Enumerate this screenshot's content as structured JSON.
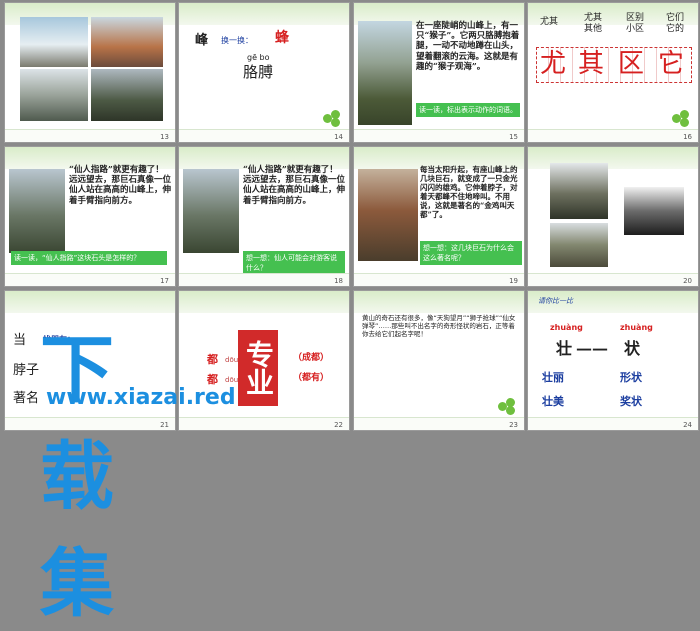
{
  "slides": {
    "s13": {
      "num": "13"
    },
    "s14": {
      "num": "14",
      "left": "峰",
      "mid": "换一换：",
      "right": "蜂",
      "pinyin": "gē bo",
      "word": "胳膊"
    },
    "s15": {
      "num": "15",
      "text": "在一座陡峭的山峰上，有一只“猴子”。它两只胳膊抱着腿，一动不动地蹲在山头，望着翻滚的云海。这就是有趣的“猴子观海”。",
      "note": "读一读，标出表示动作的词语。"
    },
    "s16": {
      "num": "16",
      "h1": "尤其",
      "h2": "尤其其他",
      "h3": "区别小区",
      "h4": "它们它的",
      "chars": [
        "尤",
        "其",
        "区",
        "它"
      ]
    },
    "s17": {
      "num": "17",
      "text": "“仙人指路”就更有趣了！远远望去，那巨石真像一位仙人站在高高的山峰上，伸着手臂指向前方。",
      "note": "读一读，“仙人指路”这块石头是怎样的？"
    },
    "s18": {
      "num": "18",
      "text": "“仙人指路”就更有趣了！远远望去，那巨石真像一位仙人站在高高的山峰上，伸着手臂指向前方。",
      "note": "想一想：仙人可能会对游客说什么？"
    },
    "s19": {
      "num": "19",
      "text": "每当太阳升起，有座山峰上的几块巨石，就变成了一只金光闪闪的雄鸡。它伸着脖子，对着天都峰不住地啼叫。不用说，这就是著名的“金鸡叫天都”了。",
      "note": "想一想：这几块巨石为什么会这么著名呢？"
    },
    "s20": {
      "num": "20"
    },
    "s21": {
      "num": "21",
      "w1": "当",
      "w2": "脖子",
      "w3": "著名",
      "find": "找朋友："
    },
    "s22": {
      "num": "22",
      "a1": "都",
      "p1": "dōu",
      "r1": "（成都）",
      "a2": "都",
      "p2": "dōu",
      "r2": "（都有）"
    },
    "s23": {
      "num": "23",
      "text": "黄山的奇石还有很多，像“天狗望月”“狮子抢球”“仙女弹琴”……那些叫不出名字的奇形怪状的岩石，正等着你去给它们起名字呢！"
    },
    "s24": {
      "num": "24",
      "title": "请你比一比",
      "py1": "zhuàng",
      "py2": "zhuàng",
      "c1": "壮",
      "dash": "——",
      "c2": "状",
      "w1": "壮丽",
      "w2": "形状",
      "w3": "壮美",
      "w4": "奖状"
    }
  },
  "watermark": {
    "title": "下载集",
    "url": "www.xiazai.red",
    "stamp": "专业"
  }
}
